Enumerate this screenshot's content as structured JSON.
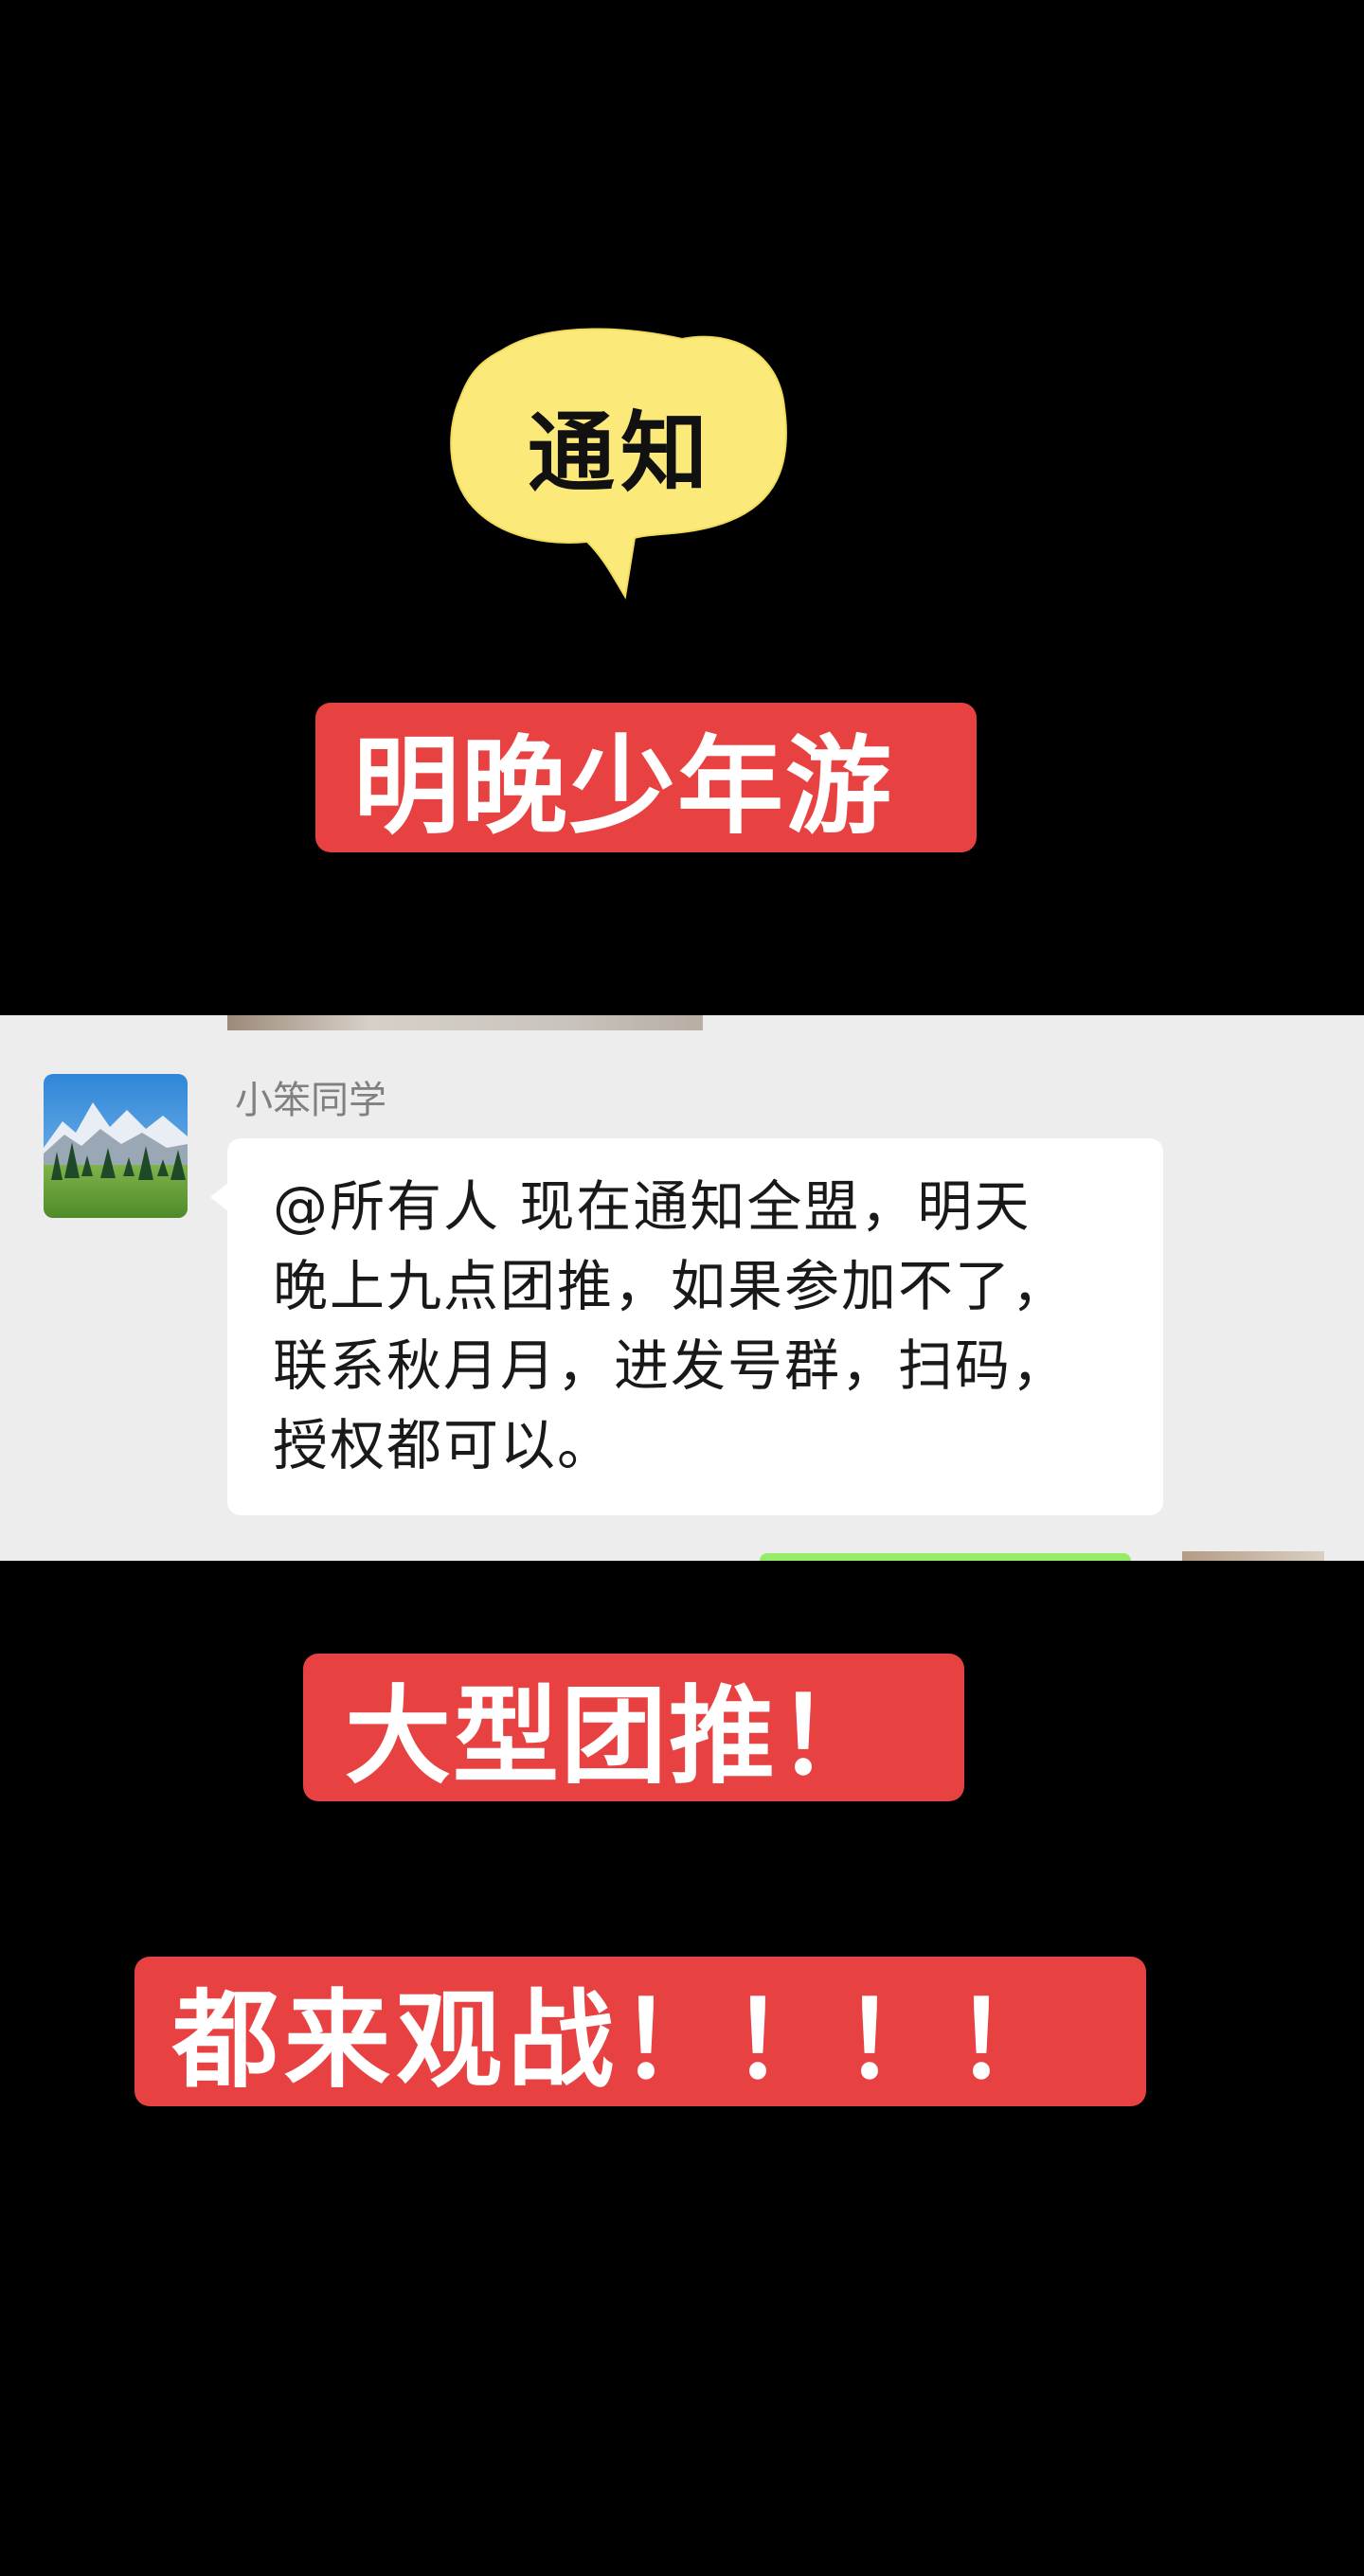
{
  "notice": {
    "label": "通知",
    "bubble_color": "#fbe97a"
  },
  "captions": {
    "line1": "明晚少年游",
    "line2": "大型团推！",
    "line3": "都来观战！！！！",
    "banner_color": "#e84142"
  },
  "chat": {
    "sender_name": "小笨同学",
    "avatar_icon": "mountain-landscape-avatar",
    "message": "@所有人  现在通知全盟，明天晚上九点团推，如果参加不了，联系秋月月，进发号群，扫码，授权都可以。",
    "message_lines": [
      "@所有人  现在通知全盟，明天",
      "晚上九点团推，如果参加不了，",
      "联系秋月月，进发号群，扫码，",
      "授权都可以。"
    ],
    "background_color": "#ededed",
    "bubble_color": "#ffffff"
  }
}
